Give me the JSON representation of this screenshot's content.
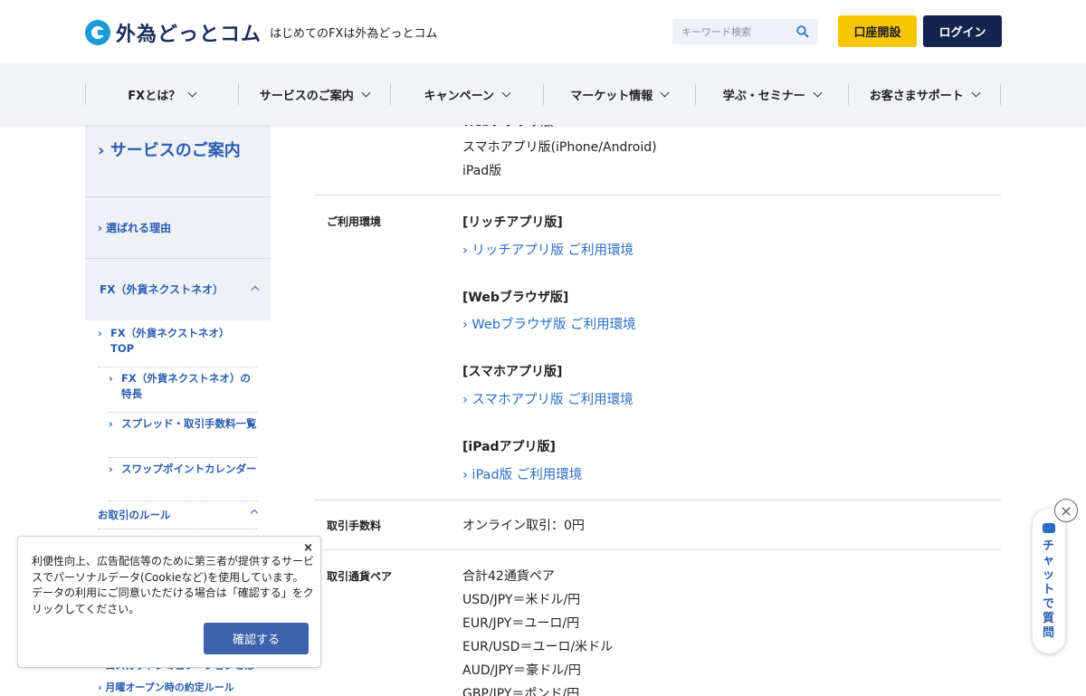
{
  "header": {
    "logo_text": "外為どっとコム",
    "tagline": "はじめてのFXは外為どっとコム",
    "search_placeholder": "キーワード検索",
    "open_account_label": "口座開設",
    "login_label": "ログイン"
  },
  "nav": {
    "items": [
      {
        "label": "FXとは？"
      },
      {
        "label": "サービスのご案内"
      },
      {
        "label": "キャンペーン"
      },
      {
        "label": "マーケット情報"
      },
      {
        "label": "学ぶ・セミナー"
      },
      {
        "label": "お客さまサポート"
      }
    ]
  },
  "sidebar": {
    "section_title": "サービスのご案内",
    "reason_label": "選ばれる理由",
    "fx_label": "FX（外貨ネクストネオ）",
    "sub_items": [
      {
        "label": "FX（外貨ネクストネオ）TOP"
      },
      {
        "label": "FX（外貨ネクストネオ）の特長"
      },
      {
        "label": "スプレッド・取引手数料一覧"
      },
      {
        "label": "スワップポイントカレンダー"
      }
    ],
    "rules_label": "お取引のルール",
    "bottom_items": [
      {
        "label": "ロスカットシミュレーションとは"
      },
      {
        "label": "月曜オープン時の約定ルール"
      }
    ]
  },
  "main": {
    "top_rows": [
      "Webブラウザ版",
      "スマホアプリ版(iPhone/Android)",
      "iPad版"
    ],
    "env_label": "ご利用環境",
    "env_blocks": [
      {
        "heading": "[リッチアプリ版]",
        "link": "リッチアプリ版 ご利用環境"
      },
      {
        "heading": "[Webブラウザ版]",
        "link": "Webブラウザ版 ご利用環境"
      },
      {
        "heading": "[スマホアプリ版]",
        "link": "スマホアプリ版 ご利用環境"
      },
      {
        "heading": "[iPadアプリ版]",
        "link": "iPad版 ご利用環境"
      }
    ],
    "fee_label": "取引手数料",
    "fee_value": "オンライン取引：0円",
    "pairs_label": "取引通貨ペア",
    "pairs": [
      "合計42通貨ペア",
      "USD/JPY＝米ドル/円",
      "EUR/JPY＝ユーロ/円",
      "EUR/USD＝ユーロ/米ドル",
      "AUD/JPY＝豪ドル/円",
      "GBP/JPY＝ポンド/円"
    ]
  },
  "cookie": {
    "message": "利便性向上、広告配信等のために第三者が提供するサービスでパーソナルデータ(Cookieなど)を使用しています。データの利用にご同意いただける場合は「確認する」をクリックしてください。",
    "confirm_label": "確認する",
    "close_label": "×"
  },
  "chat": {
    "label": "チャットで質問",
    "close_label": "×"
  },
  "colors": {
    "brand_blue": "#2a5db0",
    "link_blue": "#2a6cc6",
    "open_account_yellow": "#f7c600",
    "login_navy": "#15234f",
    "nav_bg": "#f1f3f6"
  }
}
